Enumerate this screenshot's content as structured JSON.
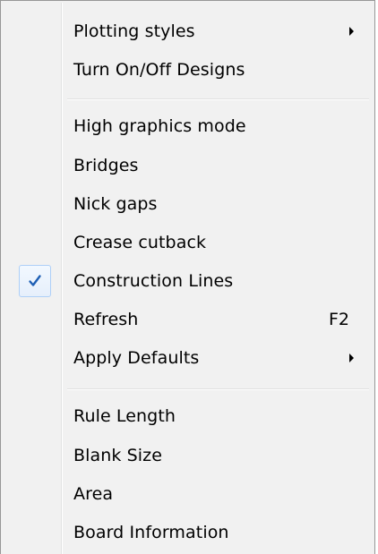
{
  "menu": {
    "items": [
      {
        "label": "Plotting styles",
        "submenu": true
      },
      {
        "label": "Turn On/Off Designs"
      },
      {
        "label": "High graphics mode"
      },
      {
        "label": "Bridges"
      },
      {
        "label": "Nick gaps"
      },
      {
        "label": "Crease cutback"
      },
      {
        "label": "Construction Lines",
        "checked": true,
        "icon": "checkmark-icon"
      },
      {
        "label": "Refresh",
        "shortcut": "F2"
      },
      {
        "label": "Apply Defaults",
        "submenu": true
      },
      {
        "label": "Rule Length"
      },
      {
        "label": "Blank Size"
      },
      {
        "label": "Area"
      },
      {
        "label": "Board Information"
      }
    ]
  },
  "colors": {
    "menu_background": "#f1f1f1",
    "menu_border": "#979797",
    "check_color": "#1e5fb4",
    "check_highlight": "#aecff7"
  }
}
